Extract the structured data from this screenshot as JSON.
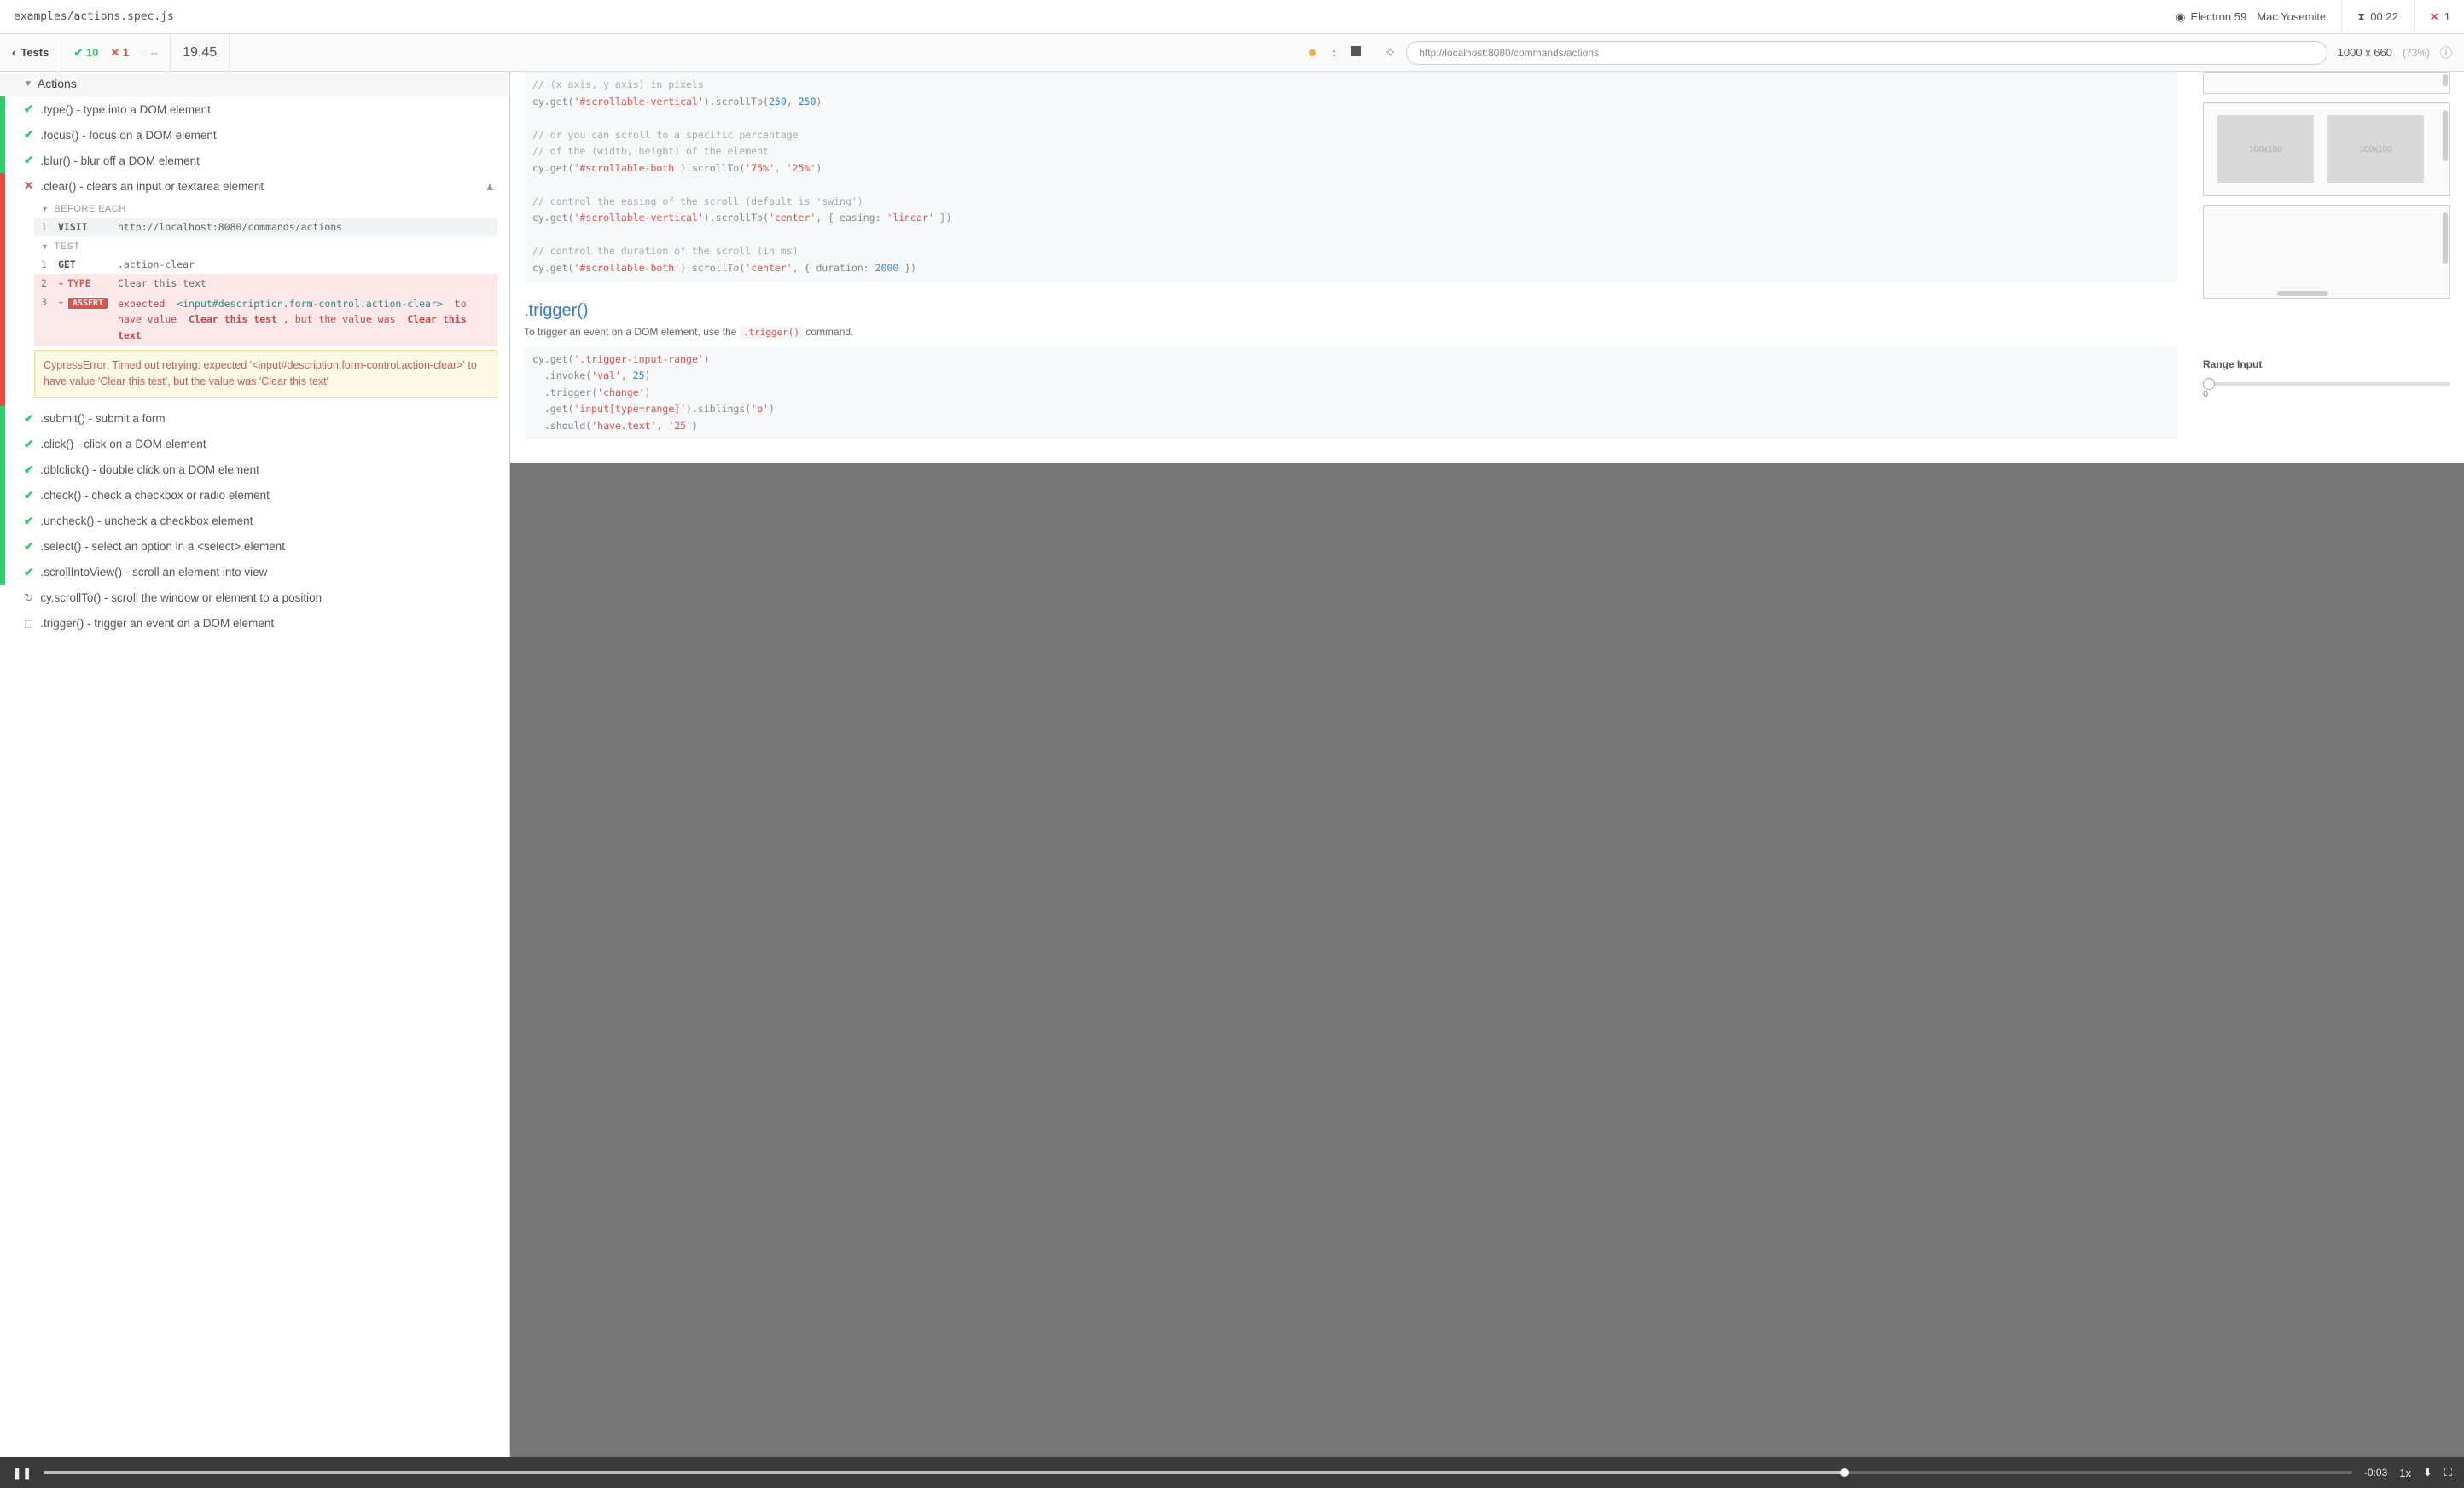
{
  "header": {
    "spec_path": "examples/actions.spec.js",
    "browser": "Electron 59",
    "os": "Mac Yosemite",
    "duration": "00:22",
    "fail_count": "1"
  },
  "toolbar": {
    "tests_label": "Tests",
    "passed": "10",
    "failed": "1",
    "pending": "--",
    "duration": "19.45",
    "url": "http://localhost:8080/commands/actions",
    "viewport": "1000 x 660",
    "viewport_pct": "(73%)"
  },
  "suite": {
    "name": "Actions"
  },
  "tests": {
    "type": ".type() - type into a DOM element",
    "focus": ".focus() - focus on a DOM element",
    "blur": ".blur() - blur off a DOM element",
    "clear": ".clear() - clears an input or textarea element",
    "submit": ".submit() - submit a form",
    "click": ".click() - click on a DOM element",
    "dblclick": ".dblclick() - double click on a DOM element",
    "check": ".check() - check a checkbox or radio element",
    "uncheck": ".uncheck() - uncheck a checkbox element",
    "select": ".select() - select an option in a <select> element",
    "scrollIntoView": ".scrollIntoView() - scroll an element into view",
    "scrollTo": "cy.scrollTo() - scroll the window or element to a position",
    "trigger": ".trigger() - trigger an event on a DOM element"
  },
  "expanded": {
    "before_each_label": "BEFORE EACH",
    "test_label": "TEST",
    "visit_cmd": "VISIT",
    "visit_arg": "http://localhost:8080/commands/actions",
    "get_cmd": "GET",
    "get_arg": ".action-clear",
    "type_cmd": "TYPE",
    "type_arg": "Clear this text",
    "assert_cmd": "ASSERT",
    "assert_pre": "expected",
    "assert_el": "<input#description.form-control.action-clear>",
    "assert_mid": "to have value",
    "assert_expected": "Clear this test",
    "assert_mid2": ", but the value was",
    "assert_actual": "Clear this text",
    "error": "CypressError: Timed out retrying: expected '<input#description.form-control.action-clear>' to have value 'Clear this test', but the value was 'Clear this text'"
  },
  "aut": {
    "code1_l1": "// (x axis, y axis) in pixels",
    "code1_l2a": "cy.get(",
    "code1_l2b": "'#scrollable-vertical'",
    "code1_l2c": ").scrollTo(",
    "code1_l2d": "250",
    "code1_l2e": "250",
    "code1_l2f": ")",
    "code1_l3": "// or you can scroll to a specific percentage",
    "code1_l4": "// of the (width, height) of the element",
    "code1_l5a": "cy.get(",
    "code1_l5b": "'#scrollable-both'",
    "code1_l5c": ").scrollTo(",
    "code1_l5d": "'75%'",
    "code1_l5e": "'25%'",
    "code1_l5f": ")",
    "code1_l6": "// control the easing of the scroll (default is 'swing')",
    "code1_l7a": "cy.get(",
    "code1_l7b": "'#scrollable-vertical'",
    "code1_l7c": ").scrollTo(",
    "code1_l7d": "'center'",
    "code1_l7e": ", { easing: ",
    "code1_l7f": "'linear'",
    "code1_l7g": " })",
    "code1_l8": "// control the duration of the scroll (in ms)",
    "code1_l9a": "cy.get(",
    "code1_l9b": "'#scrollable-both'",
    "code1_l9c": ").scrollTo(",
    "code1_l9d": "'center'",
    "code1_l9e": ", { duration: ",
    "code1_l9f": "2000",
    "code1_l9g": " })",
    "trigger_heading": ".trigger()",
    "trigger_desc_a": "To trigger an event on a DOM element, use the ",
    "trigger_desc_cmd": ".trigger()",
    "trigger_desc_b": " command.",
    "code2_l1a": "cy.get(",
    "code2_l1b": "'.trigger-input-range'",
    "code2_l1c": ")",
    "code2_l2a": "  .invoke(",
    "code2_l2b": "'val'",
    "code2_l2c": ", ",
    "code2_l2d": "25",
    "code2_l2e": ")",
    "code2_l3a": "  .trigger(",
    "code2_l3b": "'change'",
    "code2_l3c": ")",
    "code2_l4a": "  .get(",
    "code2_l4b": "'input[type=range]'",
    "code2_l4c": ").siblings(",
    "code2_l4d": "'p'",
    "code2_l4e": ")",
    "code2_l5a": "  .should(",
    "code2_l5b": "'have.text'",
    "code2_l5c": ", ",
    "code2_l5d": "'25'",
    "code2_l5e": ")",
    "range_label": "Range Input",
    "range_value": "0",
    "placeholder1": "100x100",
    "placeholder2": "100x100"
  },
  "video": {
    "time_remaining": "-0:03",
    "speed": "1x"
  }
}
